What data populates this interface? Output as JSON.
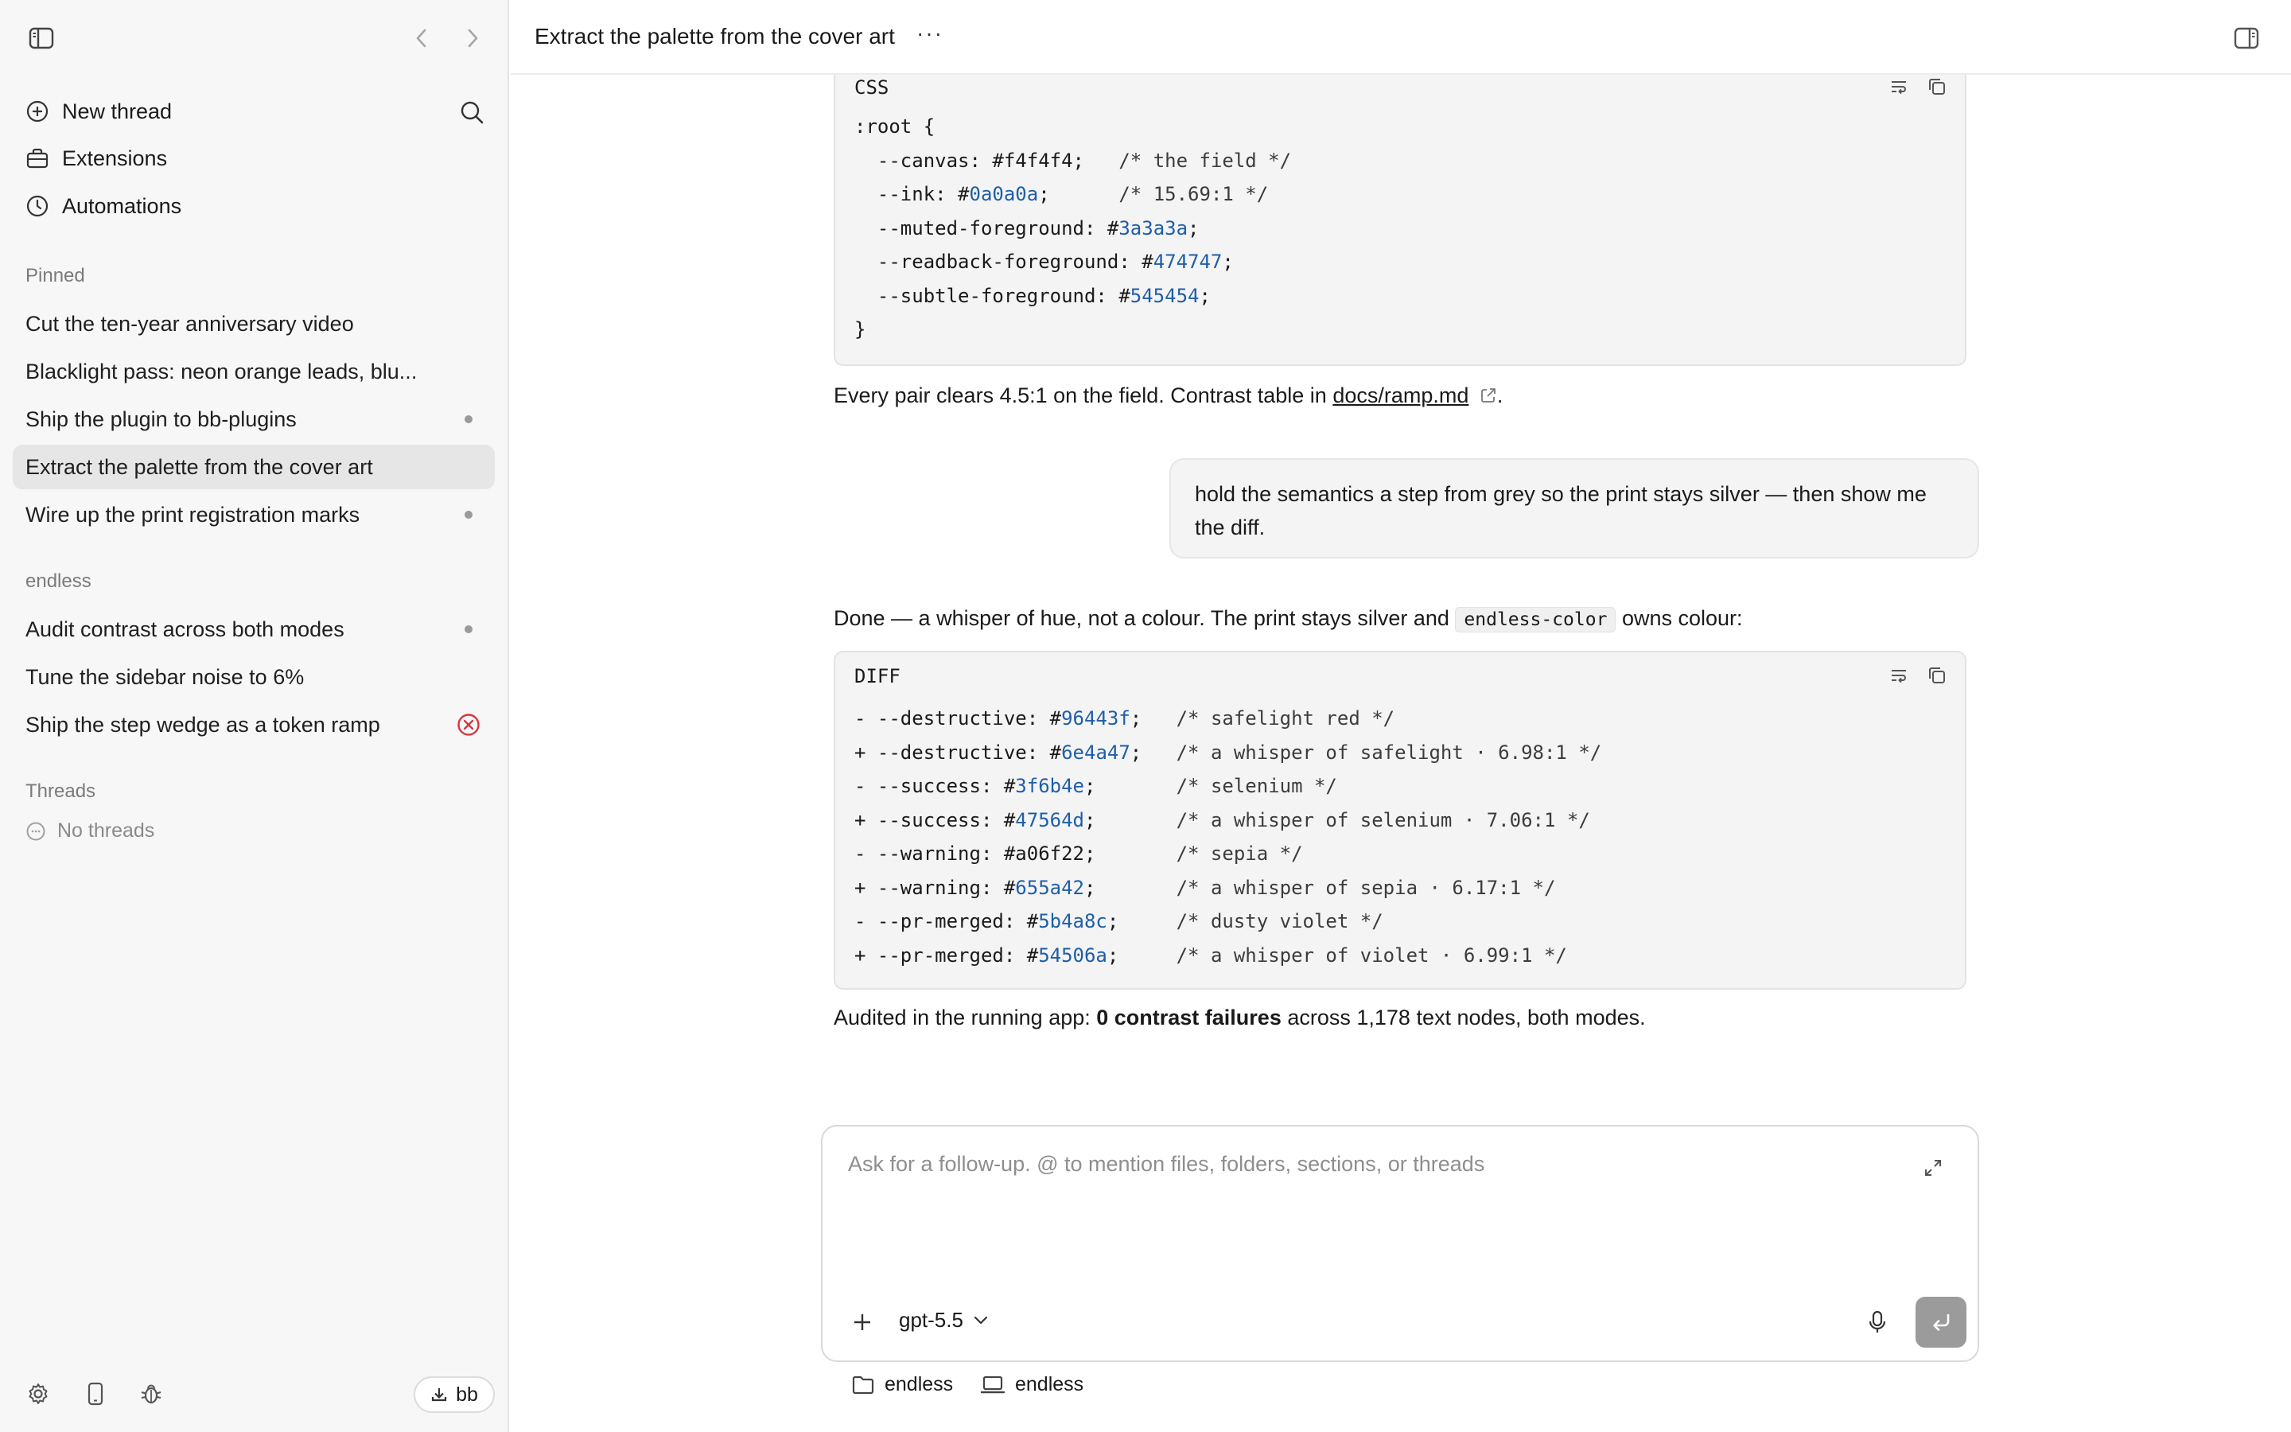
{
  "sidebar": {
    "nav": [
      {
        "label": "New thread",
        "icon": "plus-circle-icon"
      },
      {
        "label": "Extensions",
        "icon": "briefcase-icon"
      },
      {
        "label": "Automations",
        "icon": "clock-icon"
      }
    ],
    "pinned_label": "Pinned",
    "pinned": [
      {
        "label": "Cut the ten-year anniversary video",
        "status": "none"
      },
      {
        "label": "Blacklight pass: neon orange leads, blu...",
        "status": "none"
      },
      {
        "label": "Ship the plugin to bb-plugins",
        "status": "dot"
      },
      {
        "label": "Extract the palette from the cover art",
        "status": "active"
      },
      {
        "label": "Wire up the print registration marks",
        "status": "dot"
      }
    ],
    "project_label": "endless",
    "project_items": [
      {
        "label": "Audit contrast across both modes",
        "status": "dot"
      },
      {
        "label": "Tune the sidebar noise to 6%",
        "status": "none"
      },
      {
        "label": "Ship the step wedge as a token ramp",
        "status": "error"
      }
    ],
    "threads_label": "Threads",
    "no_threads": "No threads",
    "bottom": {
      "download_label": "bb"
    }
  },
  "header": {
    "title": "Extract the palette from the cover art",
    "more": "···"
  },
  "messages": {
    "css_block": {
      "lang": "CSS",
      "lines": [
        [
          {
            "t": ":root {"
          }
        ],
        [
          {
            "t": "  --canvas: #f4f4f4;   "
          },
          {
            "t": "/* the field */",
            "c": "cmt"
          }
        ],
        [
          {
            "t": "  --ink: #"
          },
          {
            "t": "0a0a0a",
            "c": "hex"
          },
          {
            "t": ";      "
          },
          {
            "t": "/* 15.69:1 */",
            "c": "cmt"
          }
        ],
        [
          {
            "t": "  --muted-foreground: #"
          },
          {
            "t": "3a3a3a",
            "c": "hex"
          },
          {
            "t": ";"
          }
        ],
        [
          {
            "t": "  --readback-foreground: #"
          },
          {
            "t": "474747",
            "c": "hex"
          },
          {
            "t": ";"
          }
        ],
        [
          {
            "t": "  --subtle-foreground: #"
          },
          {
            "t": "545454",
            "c": "hex"
          },
          {
            "t": ";"
          }
        ],
        [
          {
            "t": "}"
          }
        ]
      ]
    },
    "para1": {
      "before": "Every pair clears 4.5:1 on the field. Contrast table in ",
      "link": "docs/ramp.md",
      "after": "."
    },
    "user_message": "hold the semantics a step from grey so the print stays silver — then show me the diff.",
    "para2": {
      "before": "Done — a whisper of hue, not a colour. The print stays silver and ",
      "code": "endless-color",
      "after": " owns colour:"
    },
    "diff_block": {
      "lang": "DIFF",
      "lines": [
        [
          {
            "t": "- --destructive: #"
          },
          {
            "t": "96443f",
            "c": "hex"
          },
          {
            "t": ";   "
          },
          {
            "t": "/* safelight red */",
            "c": "cmt"
          }
        ],
        [
          {
            "t": "+ --destructive: #"
          },
          {
            "t": "6e4a47",
            "c": "hex"
          },
          {
            "t": ";   "
          },
          {
            "t": "/* a whisper of safelight · 6.98:1 */",
            "c": "cmt"
          }
        ],
        [
          {
            "t": "- --success: #"
          },
          {
            "t": "3f6b4e",
            "c": "hex"
          },
          {
            "t": ";       "
          },
          {
            "t": "/* selenium */",
            "c": "cmt"
          }
        ],
        [
          {
            "t": "+ --success: #"
          },
          {
            "t": "47564d",
            "c": "hex"
          },
          {
            "t": ";       "
          },
          {
            "t": "/* a whisper of selenium · 7.06:1 */",
            "c": "cmt"
          }
        ],
        [
          {
            "t": "- --warning: #a06f22;       "
          },
          {
            "t": "/* sepia */",
            "c": "cmt"
          }
        ],
        [
          {
            "t": "+ --warning: #"
          },
          {
            "t": "655a42",
            "c": "hex"
          },
          {
            "t": ";       "
          },
          {
            "t": "/* a whisper of sepia · 6.17:1 */",
            "c": "cmt"
          }
        ],
        [
          {
            "t": "- --pr-merged: #"
          },
          {
            "t": "5b4a8c",
            "c": "hex"
          },
          {
            "t": ";     "
          },
          {
            "t": "/* dusty violet */",
            "c": "cmt"
          }
        ],
        [
          {
            "t": "+ --pr-merged: #"
          },
          {
            "t": "54506a",
            "c": "hex"
          },
          {
            "t": ";     "
          },
          {
            "t": "/* a whisper of violet · 6.99:1 */",
            "c": "cmt"
          }
        ]
      ]
    },
    "para3": {
      "before": "Audited in the running app: ",
      "bold": "0 contrast failures",
      "after": " across 1,178 text nodes, both modes."
    }
  },
  "composer": {
    "placeholder": "Ask for a follow-up. @ to mention files, folders, sections, or threads",
    "model": "gpt-5.5"
  },
  "footer": {
    "folder_label": "endless",
    "machine_label": "endless"
  },
  "colors": {
    "accent_error": "#d9363e",
    "code_hex": "#1f5ea8",
    "sidebar_bg": "#f7f7f7",
    "active_item_bg": "#e6e6e6"
  }
}
